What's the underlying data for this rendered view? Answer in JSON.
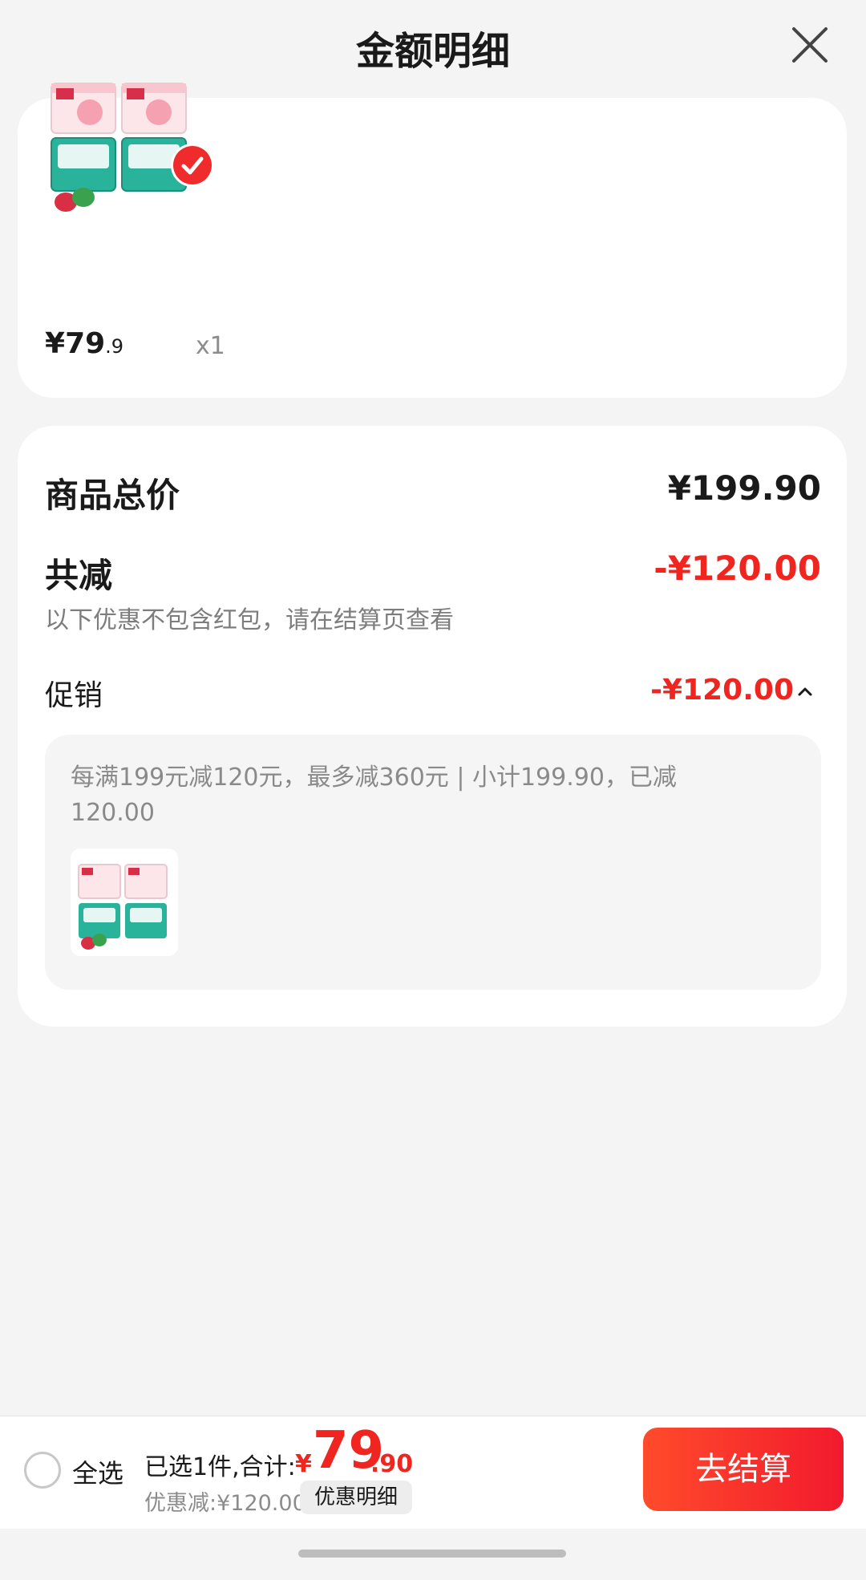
{
  "header": {
    "title": "金额明细"
  },
  "product": {
    "price_symbol": "¥",
    "price_int": "79",
    "price_dec": ".9",
    "quantity": "x1"
  },
  "summary": {
    "total_label": "商品总价",
    "total_value": "¥199.90",
    "reduce_label": "共减",
    "reduce_value": "-¥120.00",
    "note": "以下优惠不包含红包，请在结算页查看",
    "promo_label": "促销",
    "promo_value": "-¥120.00",
    "promo_detail": "每满199元减120元，最多减360元 | 小计199.90，已减120.00"
  },
  "footer": {
    "select_all": "全选",
    "selected_summary": "已选1件,合计:",
    "currency": "¥",
    "total_int": "79",
    "total_dec": ".90",
    "discount": "优惠减:¥120.00",
    "detail_button": "优惠明细",
    "checkout_button": "去结算"
  },
  "colors": {
    "accent_red": "#f0251f",
    "background": "#f4f4f4",
    "card": "#ffffff"
  }
}
